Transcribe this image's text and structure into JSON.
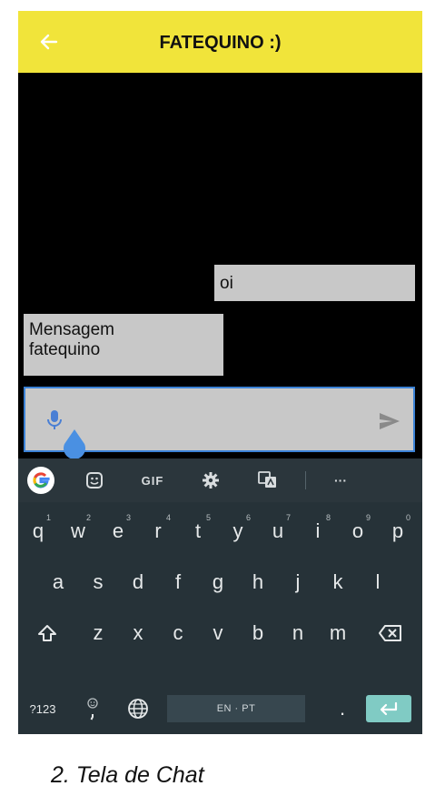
{
  "appbar": {
    "title": "FATEQUINO :)",
    "color": "#f1e43a"
  },
  "messages": [
    {
      "side": "sent",
      "text": "oi"
    },
    {
      "side": "received",
      "text": "Mensagem\nfatequino"
    }
  ],
  "input": {
    "value": "",
    "icons": [
      "mic-icon",
      "send-icon"
    ]
  },
  "keyboard": {
    "toolbar": {
      "gif_label": "GIF",
      "more_label": "···"
    },
    "rows": [
      {
        "keys": [
          "q",
          "w",
          "e",
          "r",
          "t",
          "y",
          "u",
          "i",
          "o",
          "p"
        ],
        "hints": [
          "1",
          "2",
          "3",
          "4",
          "5",
          "6",
          "7",
          "8",
          "9",
          "0"
        ]
      },
      {
        "keys": [
          "a",
          "s",
          "d",
          "f",
          "g",
          "h",
          "j",
          "k",
          "l"
        ]
      },
      {
        "keys": [
          "z",
          "x",
          "c",
          "v",
          "b",
          "n",
          "m"
        ]
      }
    ],
    "symbols_label": "?123",
    "space_label": "EN · PT",
    "period_label": ".",
    "comma_label": ","
  },
  "caption": "2.   Tela de Chat"
}
